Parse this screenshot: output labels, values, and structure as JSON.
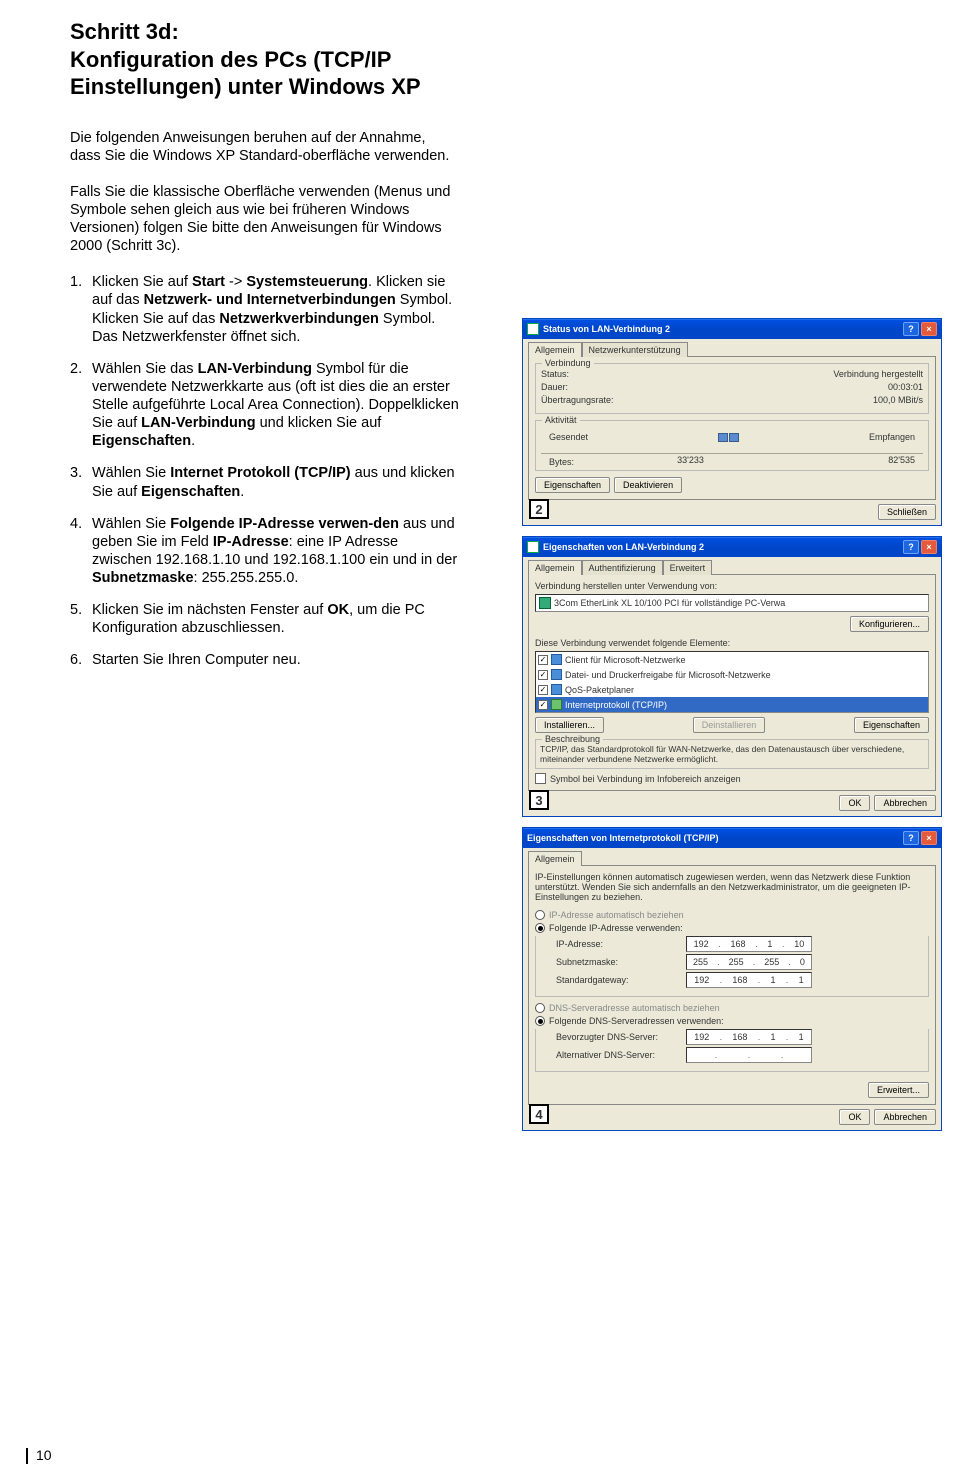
{
  "heading": {
    "line1": "Schritt 3d:",
    "line2": "Konfiguration des PCs (TCP/IP Einstellungen) unter Windows XP"
  },
  "intro1": "Die folgenden Anweisungen beruhen auf der Annahme, dass Sie die Windows XP Standard-oberfläche verwenden.",
  "intro2": "Falls Sie die klassische Oberfläche verwenden (Menus und Symbole sehen gleich aus wie bei früheren Windows Versionen) folgen Sie bitte den Anweisungen für Windows 2000 (Schritt 3c).",
  "steps": [
    {
      "n": "1.",
      "parts": [
        "Klicken Sie auf ",
        " -> ",
        ". Klicken sie auf das ",
        " Symbol. Klicken Sie auf das ",
        " Symbol. Das Netzwerkfenster öffnet sich."
      ],
      "bold": [
        "Start",
        "Systemsteuerung",
        "Netzwerk- und Internetverbindungen",
        "Netzwerkverbindungen"
      ]
    },
    {
      "n": "2.",
      "parts": [
        "Wählen Sie das ",
        " Symbol für die verwendete Netzwerkkarte aus (oft ist dies die an erster Stelle aufgeführte Local Area Connection). Doppelklicken Sie auf ",
        " und klicken Sie auf ",
        "."
      ],
      "bold": [
        "LAN-Verbindung",
        "LAN-Verbindung",
        "Eigenschaften"
      ]
    },
    {
      "n": "3.",
      "parts": [
        "Wählen Sie ",
        " aus und klicken Sie auf ",
        "."
      ],
      "bold": [
        "Internet Protokoll (TCP/IP)",
        "Eigenschaften"
      ]
    },
    {
      "n": "4.",
      "parts": [
        "Wählen Sie ",
        " aus und geben Sie im Feld ",
        ": eine IP Adresse zwischen 192.168.1.10 und 192.168.1.100 ein und in der ",
        ": 255.255.255.0."
      ],
      "bold": [
        "Folgende IP-Adresse verwen-den",
        "IP-Adresse",
        "Subnetzmaske"
      ]
    },
    {
      "n": "5.",
      "parts": [
        "Klicken Sie im nächsten Fenster auf ",
        ", um die PC Konfiguration abzuschliessen."
      ],
      "bold": [
        "OK"
      ]
    },
    {
      "n": "6.",
      "parts": [
        "Starten Sie Ihren Computer neu."
      ],
      "bold": []
    }
  ],
  "dlg_status": {
    "title": "Status von LAN-Verbindung 2",
    "tabs": [
      "Allgemein",
      "Netzwerkunterstützung"
    ],
    "group1": {
      "legend": "Verbindung",
      "rows": [
        {
          "l": "Status:",
          "v": "Verbindung hergestellt"
        },
        {
          "l": "Dauer:",
          "v": "00:03:01"
        },
        {
          "l": "Übertragungsrate:",
          "v": "100,0 MBit/s"
        }
      ]
    },
    "group2": {
      "legend": "Aktivität",
      "sent_label": "Gesendet",
      "recv_label": "Empfangen",
      "bytes_label": "Bytes:",
      "sent": "33'233",
      "recv": "82'535"
    },
    "btns": [
      "Eigenschaften",
      "Deaktivieren"
    ],
    "close": "Schließen",
    "badge": "2"
  },
  "dlg_props": {
    "title": "Eigenschaften von LAN-Verbindung 2",
    "tabs": [
      "Allgemein",
      "Authentifizierung",
      "Erweitert"
    ],
    "connect_label": "Verbindung herstellen unter Verwendung von:",
    "adapter": "3Com EtherLink XL 10/100 PCI für vollständige PC-Verwa",
    "conf_btn": "Konfigurieren...",
    "elems_label": "Diese Verbindung verwendet folgende Elemente:",
    "items": [
      "Client für Microsoft-Netzwerke",
      "Datei- und Druckerfreigabe für Microsoft-Netzwerke",
      "QoS-Paketplaner",
      "Internetprotokoll (TCP/IP)"
    ],
    "row_btns": [
      "Installieren...",
      "Deinstallieren",
      "Eigenschaften"
    ],
    "desc_legend": "Beschreibung",
    "desc": "TCP/IP, das Standardprotokoll für WAN-Netzwerke, das den Datenaustausch über verschiedene, miteinander verbundene Netzwerke ermöglicht.",
    "chk": "Symbol bei Verbindung im Infobereich anzeigen",
    "ok": "OK",
    "cancel": "Abbrechen",
    "badge": "3"
  },
  "dlg_tcpip": {
    "title": "Eigenschaften von Internetprotokoll (TCP/IP)",
    "tab": "Allgemein",
    "blurb": "IP-Einstellungen können automatisch zugewiesen werden, wenn das Netzwerk diese Funktion unterstützt. Wenden Sie sich andernfalls an den Netzwerkadministrator, um die geeigneten IP-Einstellungen zu beziehen.",
    "r1": "IP-Adresse automatisch beziehen",
    "r2": "Folgende IP-Adresse verwenden:",
    "ip_label": "IP-Adresse:",
    "ip": [
      "192",
      "168",
      "1",
      "10"
    ],
    "mask_label": "Subnetzmaske:",
    "mask": [
      "255",
      "255",
      "255",
      "0"
    ],
    "gw_label": "Standardgateway:",
    "gw": [
      "192",
      "168",
      "1",
      "1"
    ],
    "r3": "DNS-Serveradresse automatisch beziehen",
    "r4": "Folgende DNS-Serveradressen verwenden:",
    "dns1_label": "Bevorzugter DNS-Server:",
    "dns1": [
      "192",
      "168",
      "1",
      "1"
    ],
    "dns2_label": "Alternativer DNS-Server:",
    "dns2": [
      "",
      "",
      "",
      ""
    ],
    "adv": "Erweitert...",
    "ok": "OK",
    "cancel": "Abbrechen",
    "badge": "4"
  },
  "page_number": "10"
}
